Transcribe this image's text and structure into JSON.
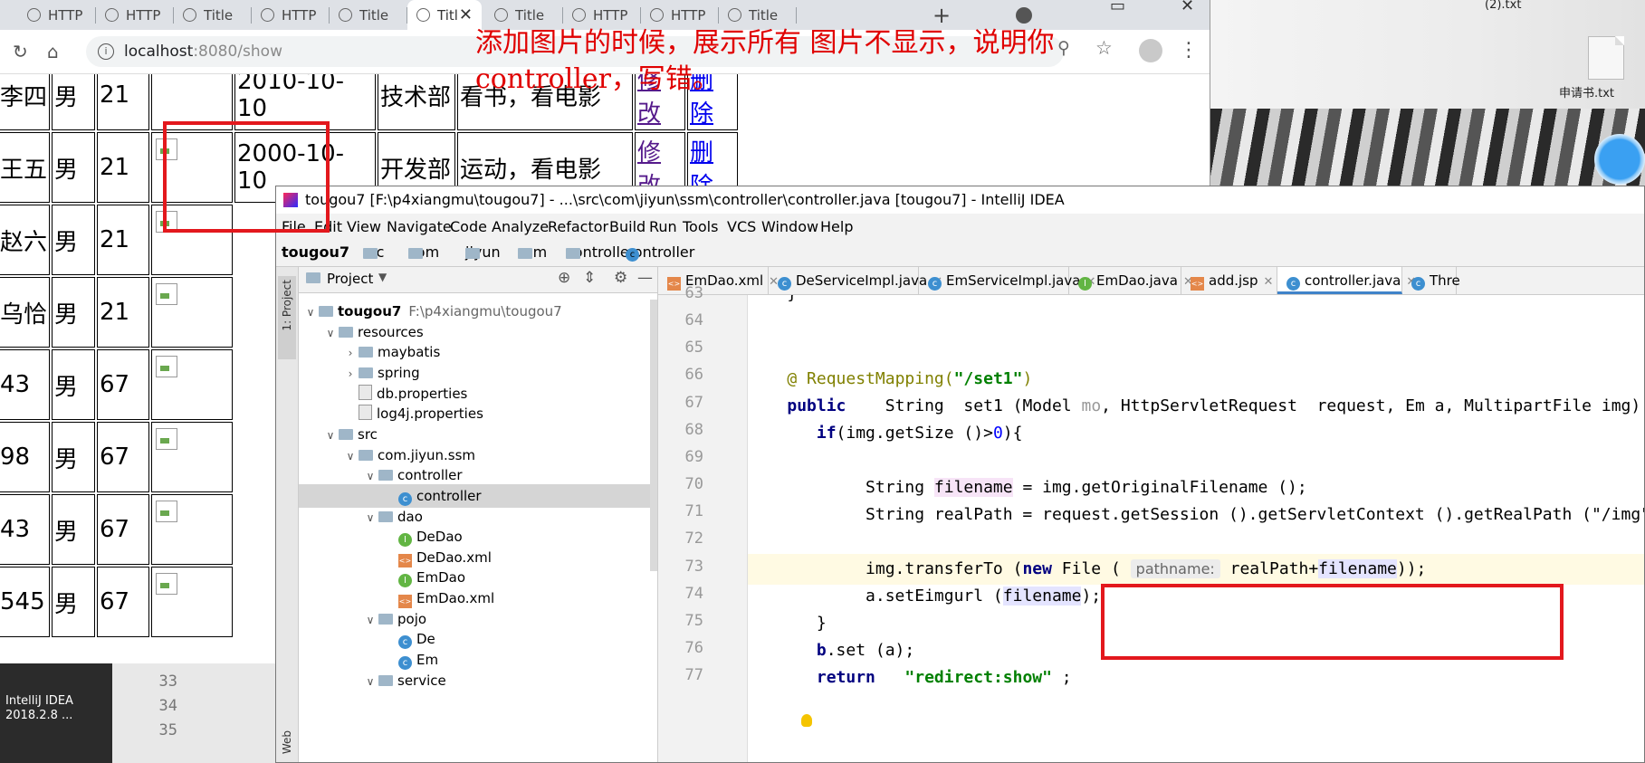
{
  "desktop": {
    "file1": "(2).txt",
    "file2": "申请书.txt",
    "taskbar_app_line1": "IntelliJ IDEA",
    "taskbar_app_line2": "2018.2.8 ...",
    "code_lines": [
      "33",
      "34",
      "35"
    ]
  },
  "browser": {
    "tabs": [
      {
        "label": "HTTP",
        "active": false
      },
      {
        "label": "HTTP",
        "active": false
      },
      {
        "label": "Title",
        "active": false
      },
      {
        "label": "HTTP",
        "active": false
      },
      {
        "label": "Title",
        "active": false
      },
      {
        "label": "Titl",
        "active": true
      },
      {
        "label": "Title",
        "active": false
      },
      {
        "label": "HTTP",
        "active": false
      },
      {
        "label": "HTTP",
        "active": false
      },
      {
        "label": "Title",
        "active": false
      }
    ],
    "new_tab": "+",
    "url_host": "localhost",
    "url_rest": ":8080/show",
    "annotation": "添加图片的时候，展示所有 图片不显示，说明你controller，写错。"
  },
  "employees": [
    {
      "name": "李四",
      "sex": "男",
      "age": "21",
      "date": "2010-10-10",
      "dept": "技术部",
      "hobby": "看书，看电影",
      "edit": "修改",
      "del": "删除"
    },
    {
      "name": "王五",
      "sex": "男",
      "age": "21",
      "date": "2000-10-10",
      "dept": "开发部",
      "hobby": "运动，看电影",
      "edit": "修改",
      "del": "删除"
    },
    {
      "name": "赵六",
      "sex": "男",
      "age": "21"
    },
    {
      "name": "乌恰",
      "sex": "男",
      "age": "21"
    },
    {
      "name": "43",
      "sex": "男",
      "age": "67"
    },
    {
      "name": "98",
      "sex": "男",
      "age": "67"
    },
    {
      "name": "43",
      "sex": "男",
      "age": "67"
    },
    {
      "name": "545",
      "sex": "男",
      "age": "67"
    }
  ],
  "ide": {
    "title": "tougou7 [F:\\p4xiangmu\\tougou7] - ...\\src\\com\\jiyun\\ssm\\controller\\controller.java [tougou7] - IntelliJ IDEA",
    "menu": [
      "File",
      "Edit",
      "View",
      "Navigate",
      "Code",
      "Analyze",
      "Refactor",
      "Build",
      "Run",
      "Tools",
      "VCS",
      "Window",
      "Help"
    ],
    "breadcrumb": [
      "tougou7",
      "src",
      "com",
      "jiyun",
      "ssm",
      "controller",
      "controller"
    ],
    "project_label": "Project",
    "side_label": "1: Project",
    "web_label": "Web",
    "tree": [
      {
        "label": "tougou7",
        "path": "F:\\p4xiangmu\\tougou7",
        "icon": "folder",
        "arrow": "down",
        "indent": 0,
        "bold": true
      },
      {
        "label": "resources",
        "icon": "folder",
        "arrow": "down",
        "indent": 1
      },
      {
        "label": "maybatis",
        "icon": "folder",
        "arrow": "right",
        "indent": 2
      },
      {
        "label": "spring",
        "icon": "folder",
        "arrow": "right",
        "indent": 2
      },
      {
        "label": "db.properties",
        "icon": "prop",
        "arrow": "",
        "indent": 2
      },
      {
        "label": "log4j.properties",
        "icon": "prop",
        "arrow": "",
        "indent": 2
      },
      {
        "label": "src",
        "icon": "folder",
        "arrow": "down",
        "indent": 1
      },
      {
        "label": "com.jiyun.ssm",
        "icon": "folder",
        "arrow": "down",
        "indent": 2
      },
      {
        "label": "controller",
        "icon": "folder",
        "arrow": "down",
        "indent": 3
      },
      {
        "label": "controller",
        "icon": "class",
        "arrow": "",
        "indent": 4,
        "selected": true
      },
      {
        "label": "dao",
        "icon": "folder",
        "arrow": "down",
        "indent": 3
      },
      {
        "label": "DeDao",
        "icon": "int",
        "arrow": "",
        "indent": 4
      },
      {
        "label": "DeDao.xml",
        "icon": "xml",
        "arrow": "",
        "indent": 4
      },
      {
        "label": "EmDao",
        "icon": "int",
        "arrow": "",
        "indent": 4
      },
      {
        "label": "EmDao.xml",
        "icon": "xml",
        "arrow": "",
        "indent": 4
      },
      {
        "label": "pojo",
        "icon": "folder",
        "arrow": "down",
        "indent": 3
      },
      {
        "label": "De",
        "icon": "class",
        "arrow": "",
        "indent": 4
      },
      {
        "label": "Em",
        "icon": "class",
        "arrow": "",
        "indent": 4
      },
      {
        "label": "service",
        "icon": "folder",
        "arrow": "down",
        "indent": 3
      }
    ],
    "editor_tabs": [
      {
        "label": "EmDao.xml",
        "icon": "xml"
      },
      {
        "label": "DeServiceImpl.java",
        "icon": "class"
      },
      {
        "label": "EmServiceImpl.java",
        "icon": "class"
      },
      {
        "label": "EmDao.java",
        "icon": "int"
      },
      {
        "label": "add.jsp",
        "icon": "xml"
      },
      {
        "label": "controller.java",
        "icon": "class",
        "active": true
      },
      {
        "label": "Thre",
        "icon": "class"
      }
    ],
    "line_numbers": [
      "63",
      "64",
      "65",
      "66",
      "67",
      "68",
      "69",
      "70",
      "71",
      "72",
      "73",
      "74",
      "75",
      "76",
      "77"
    ]
  }
}
